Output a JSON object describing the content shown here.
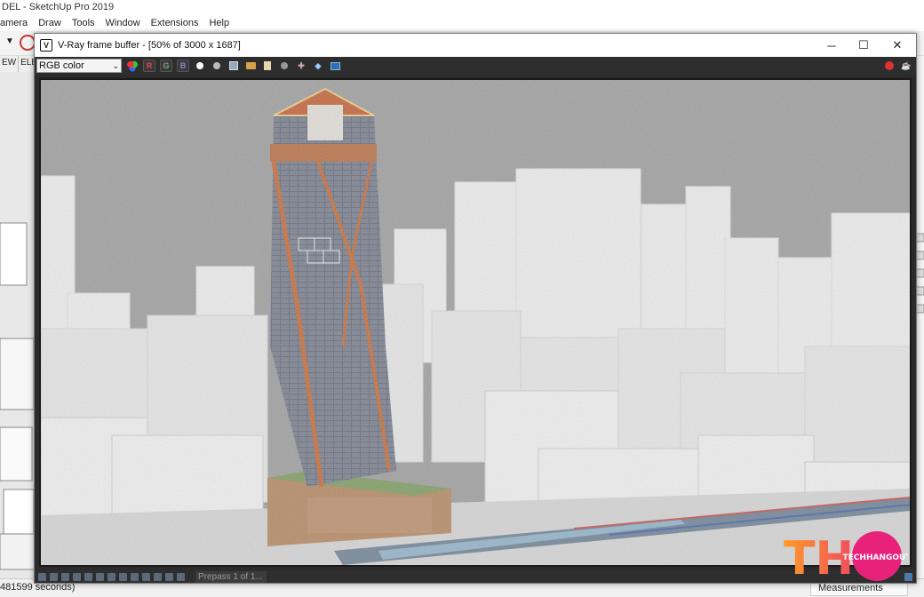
{
  "sketchup": {
    "title": "DEL - SketchUp Pro 2019",
    "menus": [
      "amera",
      "Draw",
      "Tools",
      "Window",
      "Extensions",
      "Help"
    ],
    "scene_tabs": [
      "EW",
      "ELE"
    ],
    "status_text": "481599 seconds)",
    "measurements_label": "Measurements"
  },
  "vfb": {
    "title": "V-Ray frame buffer - [50% of 3000 x 1687]",
    "channel": "RGB color",
    "channel_buttons": {
      "r": "R",
      "g": "G",
      "b": "B"
    },
    "prepass_status": "Prepass 1 of 1...",
    "window_controls": {
      "minimize": "─",
      "maximize": "☐",
      "close": "✕"
    }
  },
  "watermark": {
    "logo_text": "THO",
    "brand": "TECHHANGOUT"
  },
  "colors": {
    "accent_orange": "#c8642a",
    "watermark_gradient_start": "#ff9a2a",
    "watermark_gradient_end": "#e8227a"
  }
}
